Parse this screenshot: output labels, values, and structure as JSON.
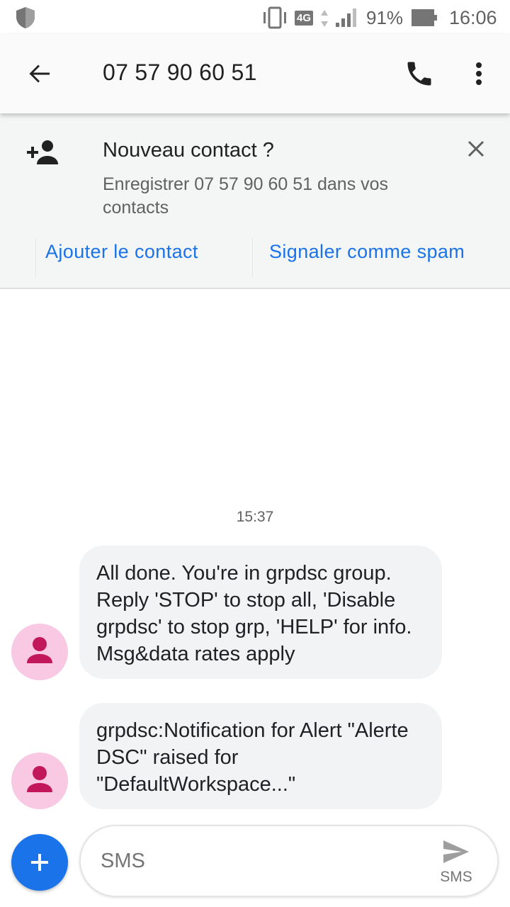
{
  "status_bar": {
    "network": "4G",
    "battery": "91%",
    "time": "16:06"
  },
  "app_bar": {
    "title": "07 57 90 60 51"
  },
  "banner": {
    "heading": "Nouveau contact ?",
    "description": "Enregistrer 07 57 90 60 51 dans vos contacts",
    "add_label": "Ajouter le contact",
    "spam_label": "Signaler comme spam"
  },
  "conversation": {
    "timestamp": "15:37",
    "messages": [
      {
        "text": "All done. You're in grpdsc group. Reply 'STOP' to stop all, 'Disable grpdsc' to stop grp, 'HELP' for info. Msg&data rates apply"
      },
      {
        "text": "grpdsc:Notification for Alert \"Alerte DSC\" raised for \"DefaultWorkspace...\""
      }
    ]
  },
  "compose": {
    "placeholder": "SMS",
    "send_label": "SMS"
  },
  "colors": {
    "accent": "#1a73e8",
    "avatar_bg": "#f9c9e3",
    "avatar_fg": "#c2185b",
    "bubble_bg": "#f1f3f4"
  },
  "icons": [
    "shield-icon",
    "vibrate-icon",
    "signal-icon",
    "battery-icon",
    "back-arrow-icon",
    "phone-icon",
    "more-vert-icon",
    "add-person-icon",
    "close-icon",
    "person-icon",
    "plus-icon",
    "send-icon"
  ]
}
